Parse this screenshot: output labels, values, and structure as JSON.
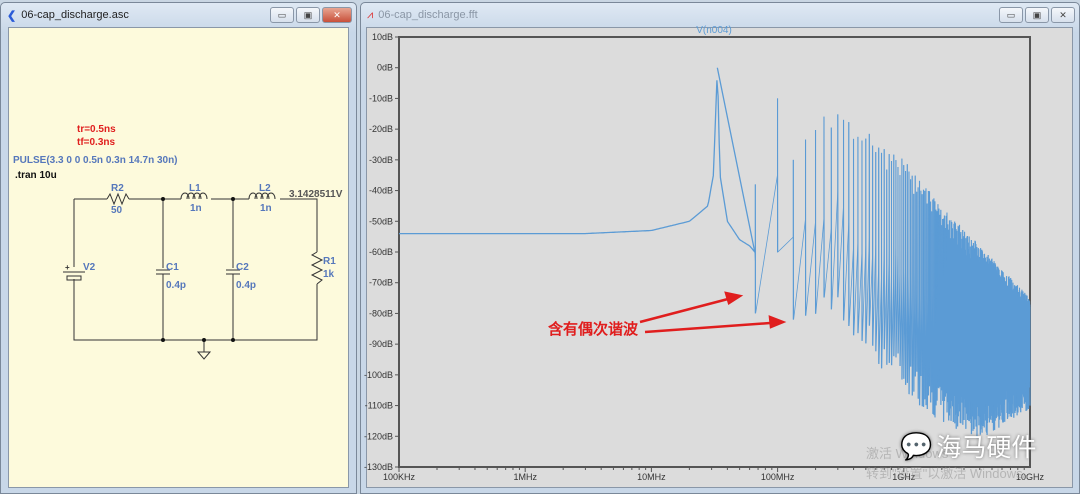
{
  "schematic_window": {
    "title": "06-cap_discharge.asc",
    "directives": {
      "tr": "tr=0.5ns",
      "tf": "tf=0.3ns",
      "pulse": "PULSE(3.3 0 0 0.5n 0.3n 14.7n 30n)",
      "tran": ".tran 10u"
    },
    "components": {
      "R2": "R2",
      "R2v": "50",
      "L1": "L1",
      "L1v": "1n",
      "L2": "L2",
      "L2v": "1n",
      "V2": "V2",
      "C1": "C1",
      "C1v": "0.4p",
      "C2": "C2",
      "C2v": "0.4p",
      "R1": "R1",
      "R1v": "1k"
    },
    "node_voltage": "3.1428511V"
  },
  "fft_window": {
    "title": "06-cap_discharge.fft"
  },
  "annotation": "含有偶次谐波",
  "watermark": {
    "text": "海马硬件",
    "activate1": "激活 Windows",
    "activate2": "转到\"设置\"以激活 Windows。"
  },
  "colors": {
    "trace": "#5b9bd5",
    "annotation": "#e01e1e"
  },
  "chart_data": {
    "type": "line",
    "title": "V(n004)",
    "xlabel": "",
    "ylabel": "",
    "xscale": "log",
    "xlim_mhz": [
      0.1,
      10000
    ],
    "ylim": [
      -130,
      10
    ],
    "xticks": [
      "100KHz",
      "1MHz",
      "10MHz",
      "100MHz",
      "1GHz",
      "10GHz"
    ],
    "yticks": [
      "10dB",
      "0dB",
      "-10dB",
      "-20dB",
      "-30dB",
      "-40dB",
      "-50dB",
      "-60dB",
      "-70dB",
      "-80dB",
      "-90dB",
      "-100dB",
      "-110dB",
      "-120dB",
      "-130dB"
    ],
    "baseline": {
      "f_mhz": [
        0.1,
        3,
        10,
        20,
        28,
        31,
        33.3,
        35,
        40,
        50,
        60,
        66
      ],
      "db": [
        -54,
        -54,
        -53,
        -50,
        -45,
        -35,
        0,
        -35,
        -50,
        -56,
        -58,
        -60
      ]
    },
    "fundamental_mhz": 33.3,
    "harmonic_top_envelope": {
      "f_mhz": [
        66.7,
        100,
        133,
        200,
        300,
        500,
        1000,
        2000,
        4000,
        10000
      ],
      "db": [
        -38,
        -10,
        -30,
        -15,
        -15,
        -20,
        -30,
        -45,
        -58,
        -75
      ]
    },
    "harmonic_bottom_envelope": {
      "f_mhz": [
        66.7,
        100,
        133,
        200,
        300,
        500,
        1000,
        2000,
        4000,
        10000
      ],
      "db": [
        -80,
        -60,
        -82,
        -75,
        -80,
        -88,
        -100,
        -110,
        -115,
        -105
      ]
    }
  }
}
